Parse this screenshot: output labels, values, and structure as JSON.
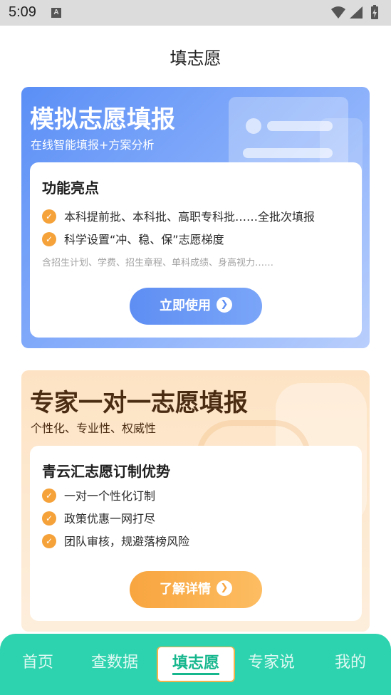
{
  "status_bar": {
    "time": "5:09",
    "notification_icon_letter": "A",
    "icons": [
      "wifi-icon",
      "signal-icon",
      "battery-icon"
    ]
  },
  "header": {
    "title": "填志愿"
  },
  "card_simulate": {
    "title": "模拟志愿填报",
    "subtitle": "在线智能填报+方案分析",
    "inner_title": "功能亮点",
    "features": [
      "本科提前批、本科批、高职专科批……全批次填报",
      "科学设置“冲、稳、保”志愿梯度"
    ],
    "note": "含招生计划、学费、招生章程、单科成绩、身高视力……",
    "button_label": "立即使用",
    "accent": "#5b8ff6"
  },
  "card_expert": {
    "title": "专家一对一志愿填报",
    "subtitle": "个性化、专业性、权威性",
    "inner_title": "青云汇志愿订制优势",
    "features": [
      "一对一个性化订制",
      "政策优惠一网打尽",
      "团队审核，规避落榜风险"
    ],
    "button_label": "了解详情",
    "accent": "#f8a53f"
  },
  "tabbar": {
    "items": [
      "首页",
      "查数据",
      "填志愿",
      "专家说",
      "我的"
    ],
    "active": "填志愿",
    "color": "#2dd3ae"
  }
}
